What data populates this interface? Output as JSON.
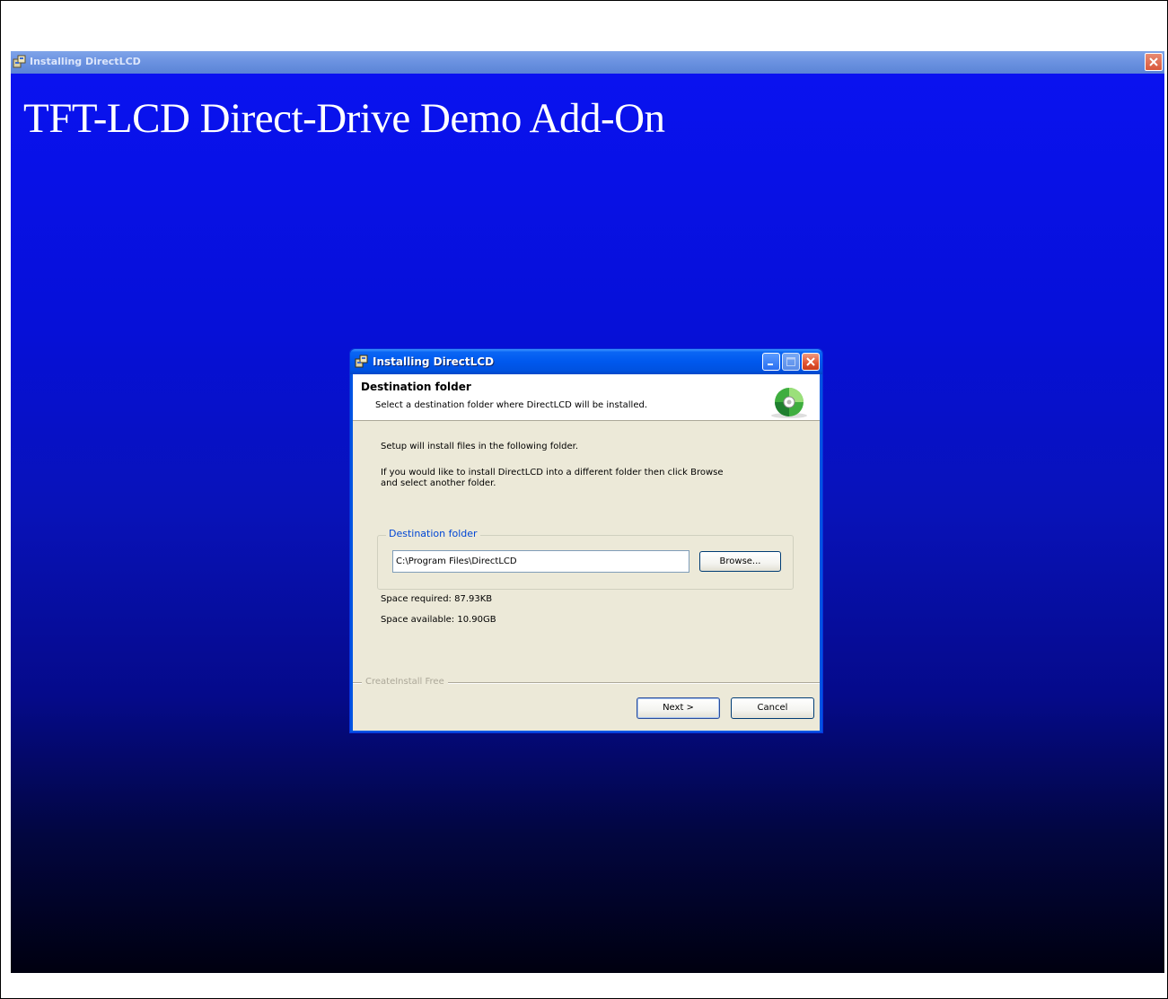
{
  "outer_window": {
    "title": "Installing DirectLCD",
    "close_icon": "close-icon",
    "app_icon": "setup-app-icon"
  },
  "headline": "TFT-LCD Direct-Drive Demo Add-On",
  "dialog": {
    "title": "Installing DirectLCD",
    "header": {
      "title": "Destination folder",
      "subtitle": "Select a destination folder where DirectLCD will be installed.",
      "icon": "cd-disc-icon"
    },
    "body": {
      "line1": "Setup will install files in the following folder.",
      "line2a": "If you would like to install DirectLCD into a different folder then click Browse",
      "line2b": "and select another folder."
    },
    "destination_group": {
      "legend": "Destination folder",
      "path_value": "C:\\Program Files\\DirectLCD",
      "browse_label": "Browse..."
    },
    "space_required": "Space required: 87.93KB",
    "space_available": "Space available: 10.90GB",
    "footer_brand": "CreateInstall Free",
    "buttons": {
      "next": "Next >",
      "cancel": "Cancel"
    }
  },
  "colors": {
    "background_top": "#0a12f2",
    "background_bottom": "#000010",
    "dialog_face": "#ece9d8",
    "titlebar_blue": "#0058ee",
    "group_legend": "#0046d5"
  }
}
